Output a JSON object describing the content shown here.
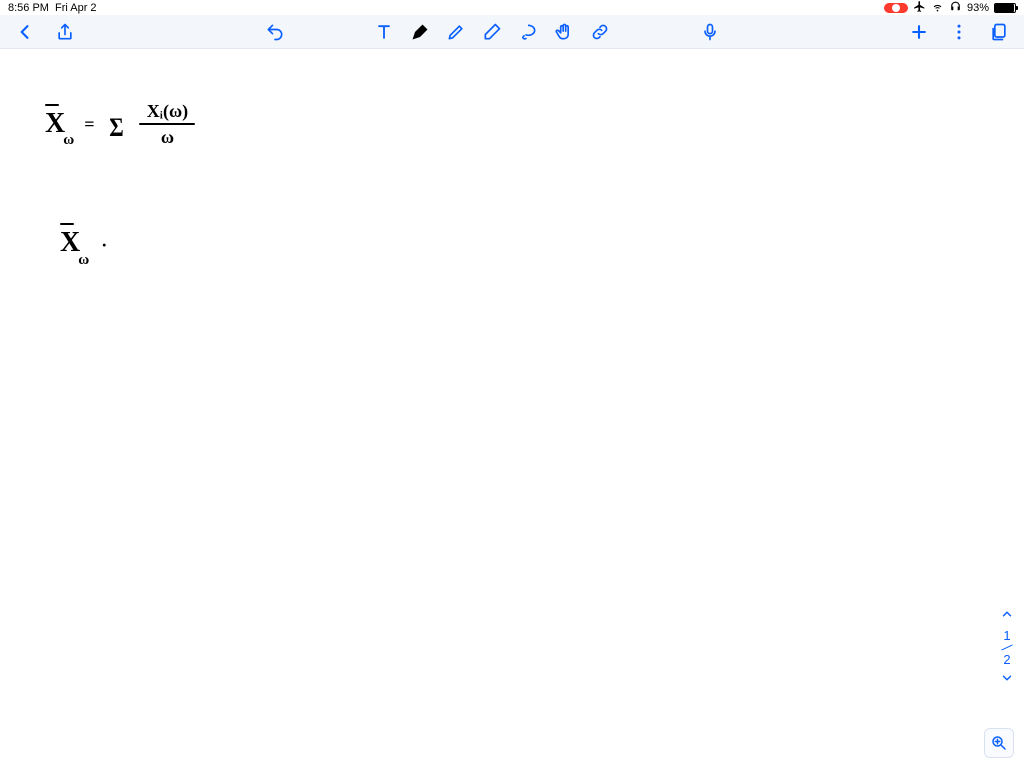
{
  "status": {
    "time": "8:56 PM",
    "date": "Fri Apr 2",
    "battery_percent": "93%",
    "battery_fill": "93%"
  },
  "toolbar": {
    "icons": {
      "back": "back",
      "share": "share",
      "undo": "undo",
      "text": "text-tool",
      "pen": "pen-tool",
      "highlighter": "highlighter-tool",
      "eraser": "eraser-tool",
      "lasso": "lasso-tool",
      "pan": "pan-tool",
      "link": "link-tool",
      "mic": "microphone",
      "add": "add",
      "more": "more",
      "pages": "pages"
    }
  },
  "page_nav": {
    "current": "1",
    "total": "2"
  },
  "handwriting": {
    "eq1": {
      "xbar": "X",
      "xbar_sub": "ω",
      "equals": "=",
      "sigma": "Σ",
      "numerator": "Xᵢ(ω)",
      "denominator": "ω"
    },
    "eq2": {
      "xbar": "X",
      "xbar_sub": "ω",
      "dot": "·"
    }
  }
}
